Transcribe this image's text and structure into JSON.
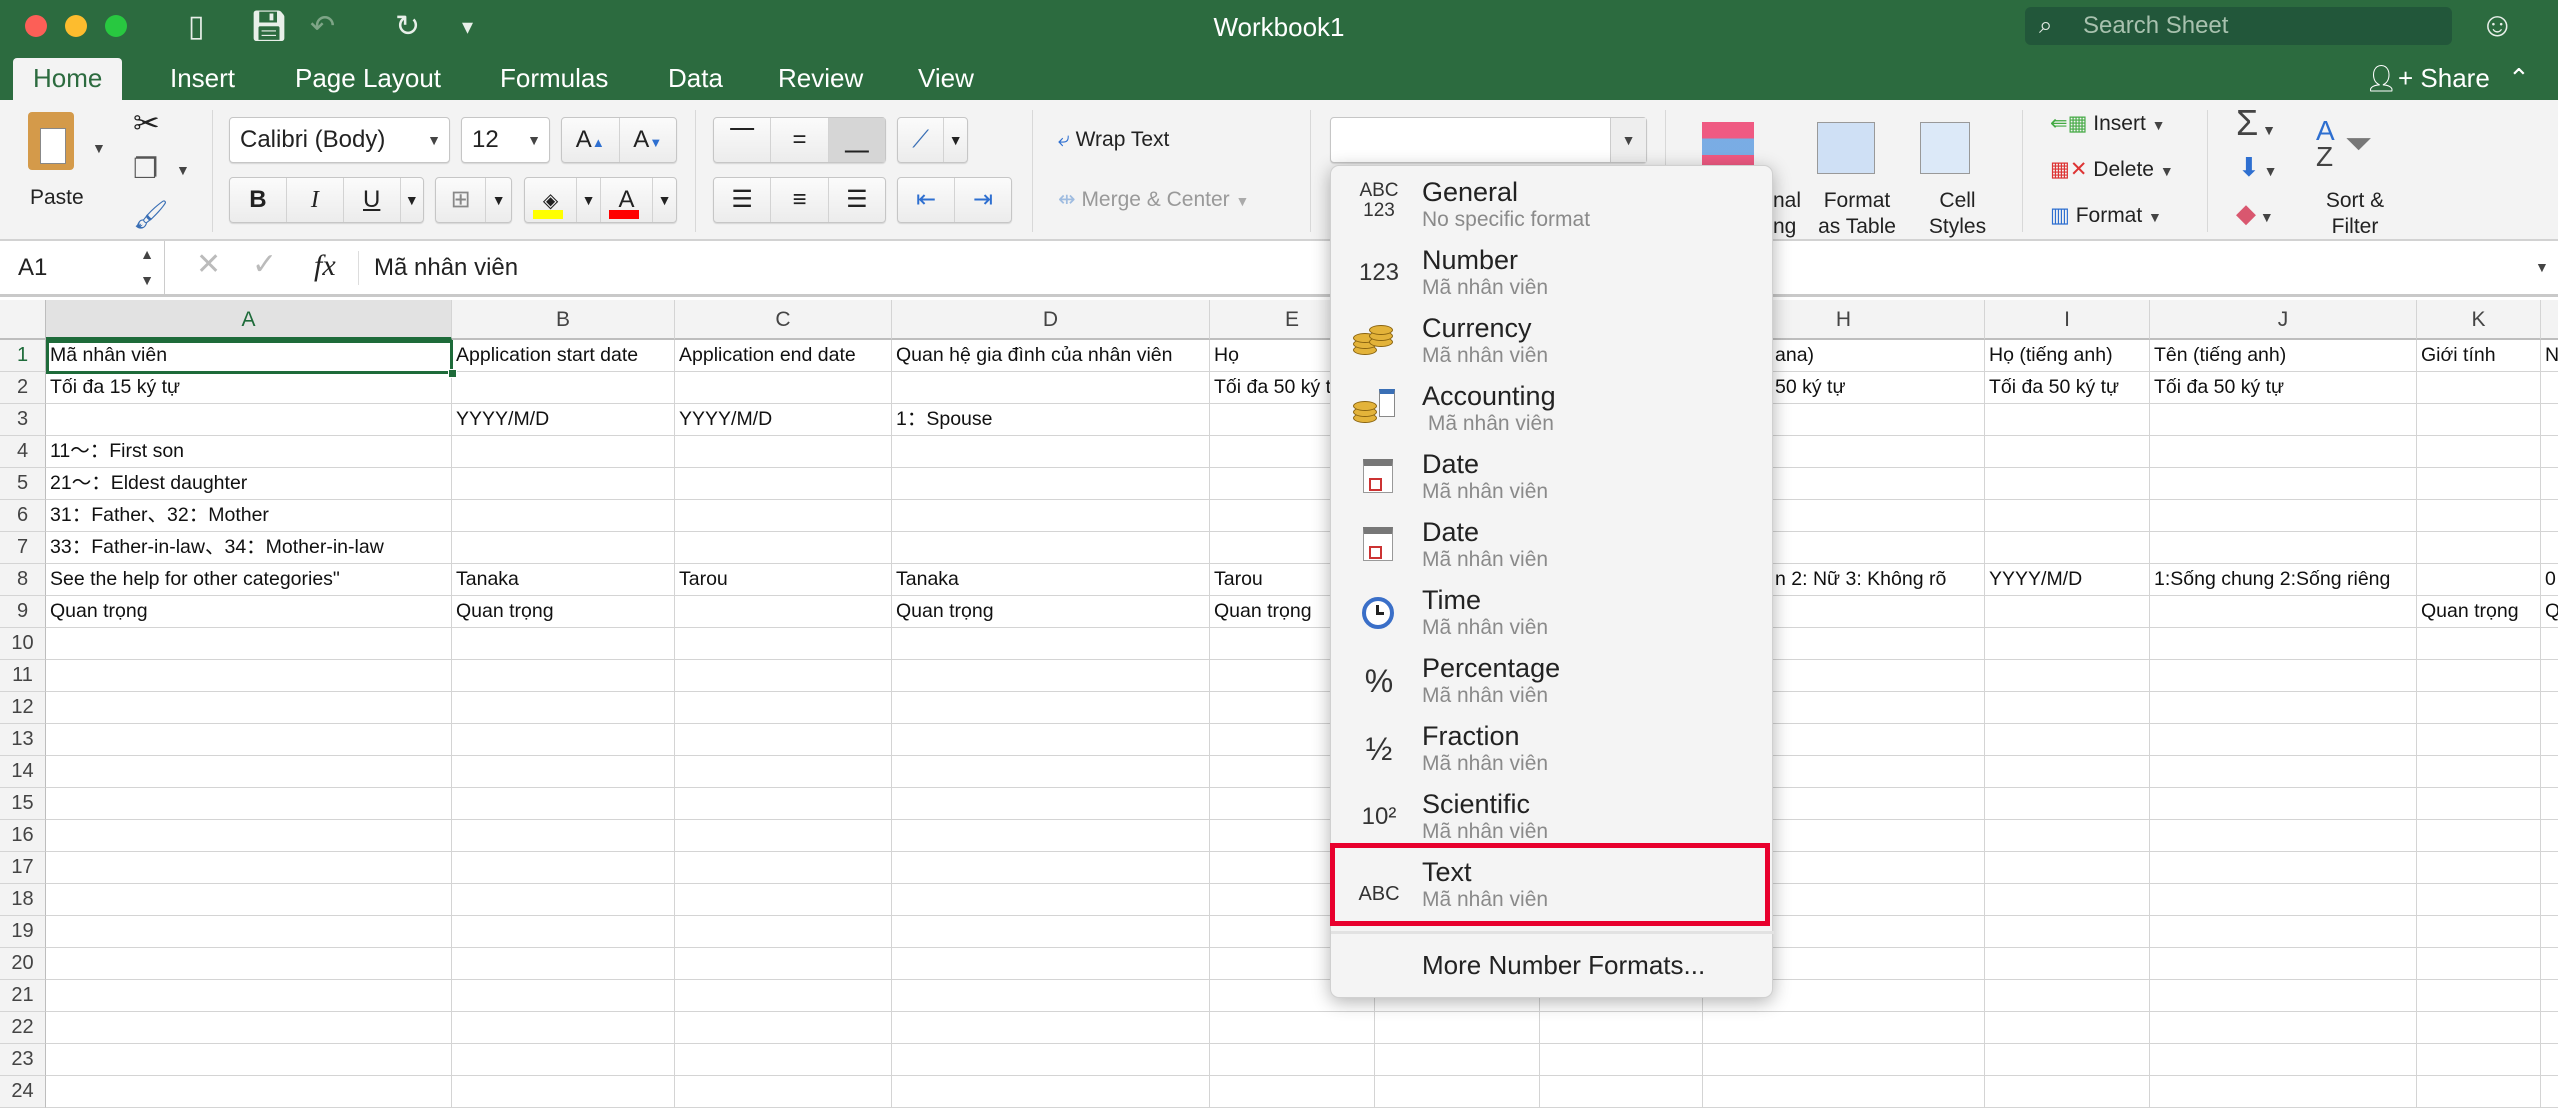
{
  "window": {
    "title": "Workbook1",
    "search_placeholder": "Search Sheet"
  },
  "tabs": [
    {
      "label": "Home",
      "active": true
    },
    {
      "label": "Insert"
    },
    {
      "label": "Page Layout"
    },
    {
      "label": "Formulas"
    },
    {
      "label": "Data"
    },
    {
      "label": "Review"
    },
    {
      "label": "View"
    }
  ],
  "share_label": "Share",
  "ribbon": {
    "paste": "Paste",
    "font_name": "Calibri (Body)",
    "font_size": "12",
    "bold": "B",
    "italic": "I",
    "underline": "U",
    "wrap_text": "Wrap Text",
    "merge_center": "Merge & Center",
    "number_format_value": "",
    "conditional_formatting_partial": [
      "nal",
      "ng"
    ],
    "format_as_table": [
      "Format",
      "as Table"
    ],
    "cell_styles": [
      "Cell",
      "Styles"
    ],
    "insert": "Insert",
    "delete": "Delete",
    "format": "Format",
    "sort_filter": [
      "Sort &",
      "Filter"
    ],
    "colors": {
      "fill": "#ffff00",
      "font": "#ff0000"
    }
  },
  "formula_bar": {
    "name_box": "A1",
    "fx": "fx",
    "content": "Mã nhân viên"
  },
  "grid": {
    "columns": [
      "A",
      "B",
      "C",
      "D",
      "E",
      "F",
      "G",
      "H",
      "I",
      "J",
      "K",
      ""
    ],
    "selected": "A1",
    "rows": [
      {
        "n": "1",
        "c": {
          "A": "Mã nhân viên",
          "B": "Application start date",
          "C": "Application end date",
          "D": "Quan hệ gia đình của nhân viên",
          "E": "Họ",
          "H": "ana)",
          "I": "Họ (tiếng anh)",
          "J": "Tên (tiếng anh)",
          "K": "Giới tính",
          "L": "N"
        }
      },
      {
        "n": "2",
        "c": {
          "A": "Tối đa 15 ký tự",
          "E": "Tối đa 50 ký tự",
          "H": "50 ký tự",
          "I": "Tối đa 50 ký tự",
          "J": "Tối đa 50 ký tự"
        }
      },
      {
        "n": "3",
        "c": {
          "B": "YYYY/M/D",
          "C": "YYYY/M/D",
          "D": "1：Spouse"
        }
      },
      {
        "n": "4",
        "c": {
          "A": "11～：First son"
        }
      },
      {
        "n": "5",
        "c": {
          "A": "21～：Eldest daughter"
        }
      },
      {
        "n": "6",
        "c": {
          "A": "31：Father、32：Mother"
        }
      },
      {
        "n": "7",
        "c": {
          "A": "33：Father-in-law、34：Mother-in-law"
        }
      },
      {
        "n": "8",
        "c": {
          "A": "See the help for other categories\"",
          "B": "Tanaka",
          "C": "Tarou",
          "D": "Tanaka",
          "E": "Tarou",
          "H": "n  2: Nữ  3: Không rõ",
          "I": "YYYY/M/D",
          "J": "1:Sống chung 2:Sống riêng",
          "L": "0"
        }
      },
      {
        "n": "9",
        "c": {
          "A": "Quan trọng",
          "B": "Quan trọng",
          "D": "Quan trọng",
          "E": "Quan trọng",
          "K": "Quan trọng",
          "L": "Q"
        }
      },
      {
        "n": "10",
        "c": {}
      },
      {
        "n": "11",
        "c": {}
      },
      {
        "n": "12",
        "c": {}
      },
      {
        "n": "13",
        "c": {}
      },
      {
        "n": "14",
        "c": {}
      },
      {
        "n": "15",
        "c": {}
      },
      {
        "n": "16",
        "c": {}
      },
      {
        "n": "17",
        "c": {}
      },
      {
        "n": "18",
        "c": {}
      },
      {
        "n": "19",
        "c": {}
      },
      {
        "n": "20",
        "c": {}
      },
      {
        "n": "21",
        "c": {}
      },
      {
        "n": "22",
        "c": {}
      },
      {
        "n": "23",
        "c": {}
      },
      {
        "n": "24",
        "c": {}
      }
    ]
  },
  "number_format_menu": {
    "items": [
      {
        "icon": "abc-123-icon",
        "glyph": "ABC\n123",
        "title": "General",
        "sub": "No specific format"
      },
      {
        "icon": "number-icon",
        "glyph": "123",
        "title": "Number",
        "sub": "Mã nhân viên"
      },
      {
        "icon": "coins-icon",
        "title": "Currency",
        "sub": "Mã nhân viên"
      },
      {
        "icon": "calculator-coins-icon",
        "title": "Accounting",
        "sub": " Mã nhân viên"
      },
      {
        "icon": "calendar-icon",
        "title": "Date",
        "sub": "Mã nhân viên"
      },
      {
        "icon": "calendar-icon",
        "title": "Date",
        "sub": "Mã nhân viên"
      },
      {
        "icon": "clock-icon",
        "title": "Time",
        "sub": "Mã nhân viên"
      },
      {
        "icon": "percent-icon",
        "glyph": "%",
        "title": "Percentage",
        "sub": "Mã nhân viên"
      },
      {
        "icon": "fraction-icon",
        "glyph": "½",
        "title": "Fraction",
        "sub": "Mã nhân viên"
      },
      {
        "icon": "scientific-icon",
        "glyph": "10²",
        "title": "Scientific",
        "sub": "Mã nhân viên"
      },
      {
        "icon": "abc-icon",
        "glyph": "ABC",
        "title": "Text",
        "sub": "Mã nhân viên",
        "highlighted": true
      }
    ],
    "more": "More Number Formats...",
    "highlight_color": "#e8002d"
  }
}
